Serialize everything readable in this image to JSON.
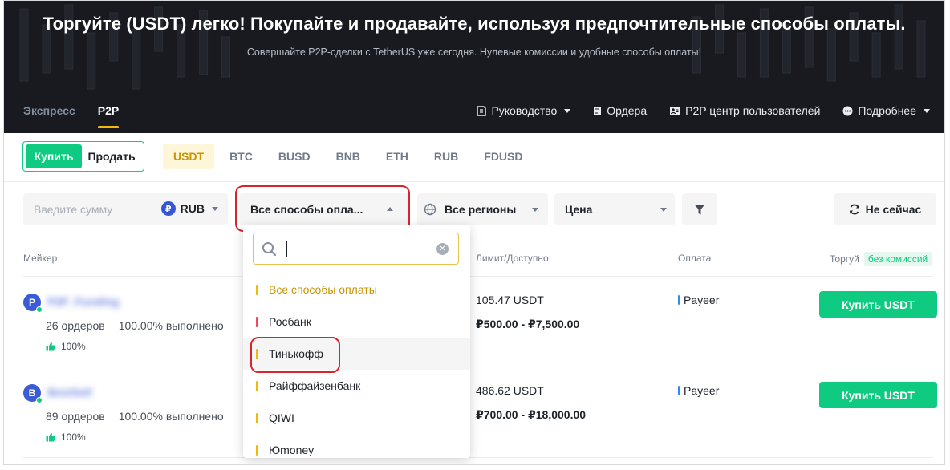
{
  "hero": {
    "title": "Торгуйте (USDT) легко! Покупайте и продавайте, используя предпочтительные способы оплаты.",
    "subtitle": "Совершайте P2P-сделки с TetherUS уже сегодня. Нулевые комиссии и удобные способы оплаты!"
  },
  "nav": {
    "left": [
      {
        "label": "Экспресс"
      },
      {
        "label": "P2P"
      }
    ],
    "right": [
      {
        "label": "Руководство",
        "icon": "book-icon"
      },
      {
        "label": "Ордера",
        "icon": "document-icon"
      },
      {
        "label": "P2P центр пользователей",
        "icon": "user-card-icon"
      },
      {
        "label": "Подробнее",
        "icon": "more-icon"
      }
    ]
  },
  "trade_toggle": {
    "buy": "Купить",
    "sell": "Продать"
  },
  "assets": [
    "USDT",
    "BTC",
    "BUSD",
    "BNB",
    "ETH",
    "RUB",
    "FDUSD"
  ],
  "filters": {
    "amount_placeholder": "Введите сумму",
    "currency": "RUB",
    "currency_symbol": "₽",
    "payment": "Все способы опла...",
    "region": "Все регионы",
    "price": "Цена",
    "refresh": "Не сейчас"
  },
  "table": {
    "headers": {
      "maker": "Мейкер",
      "limit": "Лимит/Доступно",
      "payment": "Оплата",
      "trade": "Торгуй",
      "free_badge": "без комиссий"
    },
    "rows": [
      {
        "avatar": "P",
        "nick": "P2P_Funding",
        "orders": "26 ордеров",
        "completion": "100.00% выполнено",
        "rating": "100%",
        "available": "105.47 USDT",
        "limit": "₽500.00 - ₽7,500.00",
        "payment": "Payeer",
        "action": "Купить USDT"
      },
      {
        "avatar": "B",
        "nick": "BestSell",
        "orders": "89 ордеров",
        "completion": "100.00% выполнено",
        "rating": "100%",
        "available": "486.62 USDT",
        "limit": "₽700.00 - ₽18,000.00",
        "payment": "Payeer",
        "action": "Купить USDT"
      }
    ]
  },
  "dropdown": {
    "search_value": "",
    "items": [
      {
        "label": "Все способы оплаты",
        "color": "#f0b90b",
        "selected": true
      },
      {
        "label": "Росбанк",
        "color": "#f6465d"
      },
      {
        "label": "Тинькофф",
        "color": "#f0b90b",
        "hover": true
      },
      {
        "label": "Райффайзенбанк",
        "color": "#f0b90b"
      },
      {
        "label": "QIWI",
        "color": "#f0b90b"
      },
      {
        "label": "Юmoney",
        "color": "#f0b90b"
      }
    ]
  },
  "colors": {
    "brand": "#f0b90b",
    "buy": "#0ecb81",
    "highlight": "#d8252c",
    "hero_bg": "#181a20"
  }
}
